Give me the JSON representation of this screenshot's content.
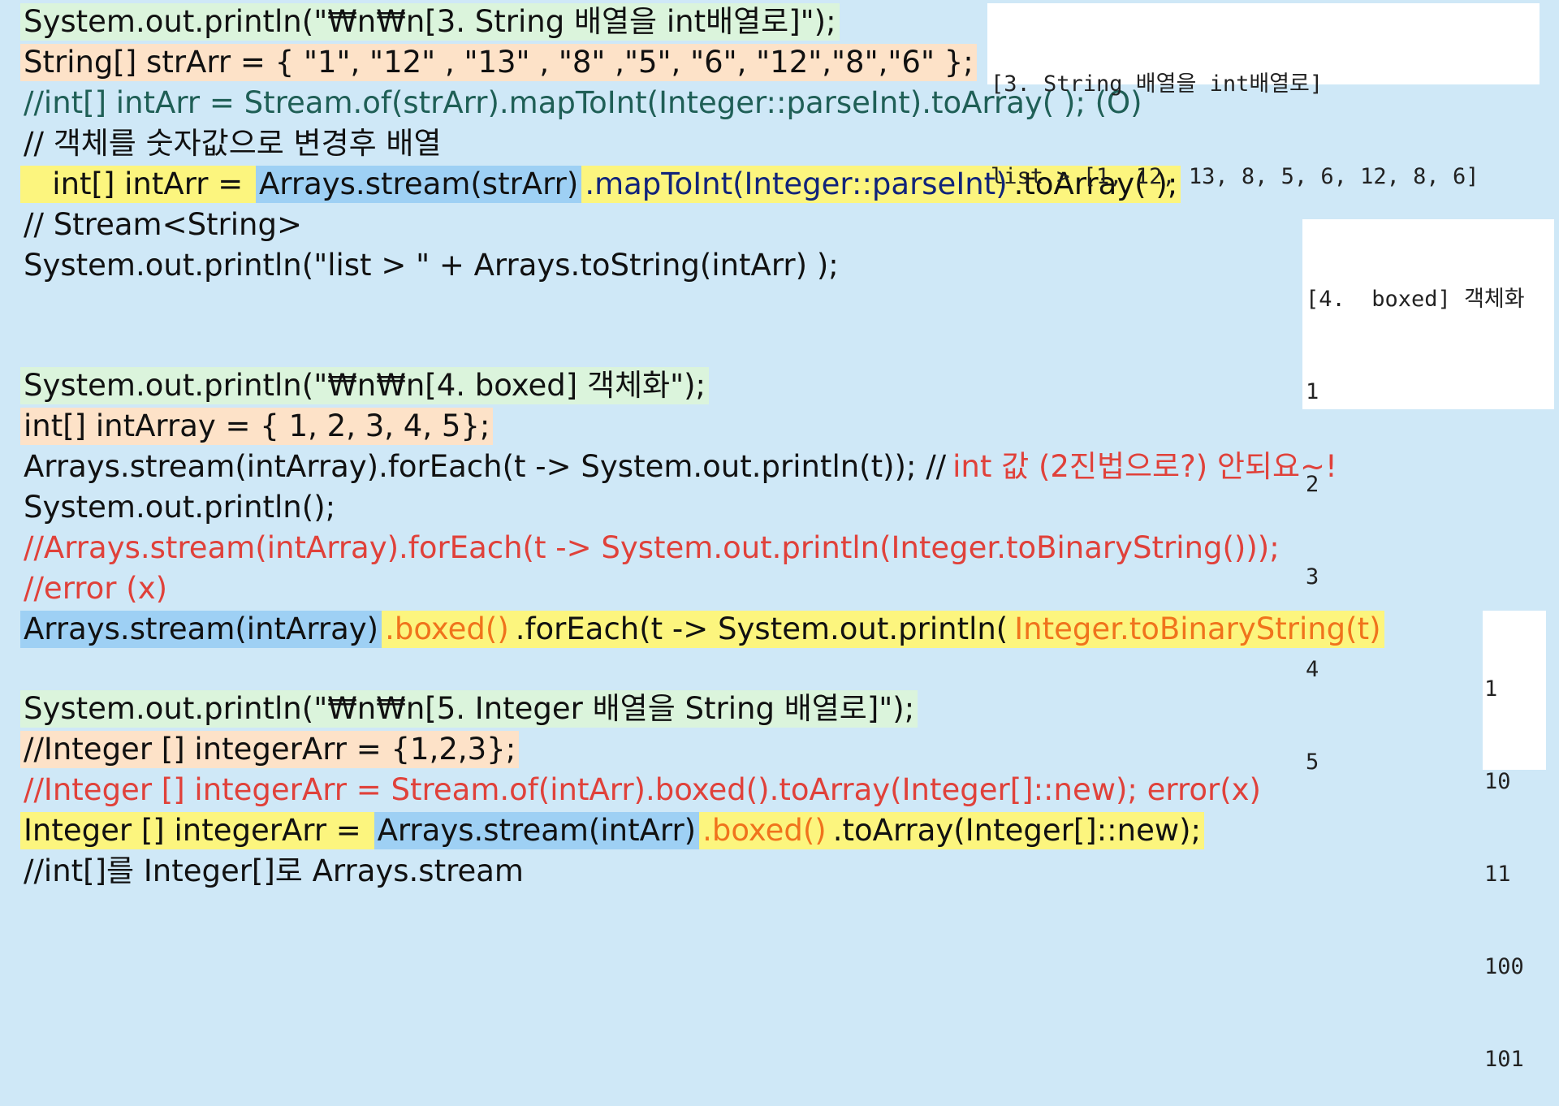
{
  "code_lines": [
    {
      "id": "line-print-section3",
      "segments": [
        {
          "text": "System.out.println(\"₩n₩n[3. String 배열을 int배열로]\");",
          "hl": "green",
          "color": "dark"
        }
      ]
    },
    {
      "id": "line-strarr-decl",
      "segments": [
        {
          "text": "String[] strArr = { \"1\", \"12\" , \"13\" , \"8\" ,\"5\", \"6\", \"12\",\"8\",\"6\" };",
          "hl": "peach",
          "color": "dark"
        }
      ]
    },
    {
      "id": "line-comment-stream-of",
      "segments": [
        {
          "text": "//int[] intArr = Stream.of(strArr).mapToInt(Integer::parseInt).toArray( ); (O)",
          "hl": "",
          "color": "teal"
        }
      ]
    },
    {
      "id": "line-comment-korean",
      "segments": [
        {
          "text": "// 객체를 숫자값으로 변경후 배열",
          "hl": "",
          "color": "dark"
        }
      ]
    },
    {
      "id": "line-intarr-stream",
      "segments": [
        {
          "text": "   int[] intArr = ",
          "hl": "yellow",
          "color": "dark"
        },
        {
          "text": "Arrays.stream(strArr)",
          "hl": "blue",
          "color": "dark"
        },
        {
          "text": ".mapToInt(Integer::parseInt)",
          "hl": "yellow",
          "color": "navy"
        },
        {
          "text": ".toArray( );",
          "hl": "yellow",
          "color": "dark"
        }
      ]
    },
    {
      "id": "line-comment-stream-string",
      "segments": [
        {
          "text": "// Stream<String>",
          "hl": "",
          "color": "dark"
        }
      ]
    },
    {
      "id": "line-print-list",
      "segments": [
        {
          "text": "System.out.println(\"list > \" + Arrays.toString(intArr) );",
          "hl": "",
          "color": "dark"
        }
      ]
    },
    {
      "id": "line-print-section4",
      "segments": [
        {
          "text": "System.out.println(\"₩n₩n[4. boxed] 객체화\");",
          "hl": "green",
          "color": "dark"
        }
      ]
    },
    {
      "id": "line-intarray-decl",
      "segments": [
        {
          "text": "int[] intArray = { 1, 2, 3, 4, 5};",
          "hl": "peach",
          "color": "dark"
        }
      ]
    },
    {
      "id": "line-foreach-print",
      "segments": [
        {
          "text": "Arrays.stream(intArray).forEach(t -> System.out.println(t)); //",
          "hl": "",
          "color": "dark"
        },
        {
          "text": "int 값 (2진법으로?) 안되요~!",
          "hl": "",
          "color": "red"
        }
      ]
    },
    {
      "id": "line-println-empty",
      "segments": [
        {
          "text": "System.out.println();",
          "hl": "",
          "color": "dark"
        }
      ]
    },
    {
      "id": "line-comment-binary",
      "segments": [
        {
          "text": "//Arrays.stream(intArray).forEach(t -> System.out.println(Integer.toBinaryString()));",
          "hl": "",
          "color": "red"
        }
      ]
    },
    {
      "id": "line-comment-error",
      "segments": [
        {
          "text": "//error (x)",
          "hl": "",
          "color": "red"
        }
      ]
    },
    {
      "id": "line-boxed-foreach",
      "segments": [
        {
          "text": "Arrays.stream(intArray)",
          "hl": "blue",
          "color": "dark"
        },
        {
          "text": ".boxed()",
          "hl": "yellow",
          "color": "orange"
        },
        {
          "text": ".forEach(t -> System.out.println(",
          "hl": "yellow",
          "color": "dark"
        },
        {
          "text": "Integer.toBinaryString(t)",
          "hl": "yellow",
          "color": "orange"
        }
      ]
    },
    {
      "id": "line-print-section5",
      "segments": [
        {
          "text": "System.out.println(\"₩n₩n[5. Integer 배열을 String 배열로]\");",
          "hl": "green",
          "color": "dark"
        }
      ]
    },
    {
      "id": "line-comment-integerarr",
      "segments": [
        {
          "text": "//Integer [] integerArr = {1,2,3};",
          "hl": "peach",
          "color": "dark"
        }
      ]
    },
    {
      "id": "line-comment-stream-error",
      "segments": [
        {
          "text": "//Integer [] integerArr = Stream.of(intArr).boxed().toArray(Integer[]::new); error(x)",
          "hl": "",
          "color": "red"
        }
      ]
    },
    {
      "id": "line-integerarr-stream",
      "segments": [
        {
          "text": "Integer [] integerArr = ",
          "hl": "yellow",
          "color": "dark"
        },
        {
          "text": "Arrays.stream(intArr)",
          "hl": "blue",
          "color": "dark"
        },
        {
          "text": ".boxed()",
          "hl": "yellow",
          "color": "orange"
        },
        {
          "text": ".toArray(Integer[]::new);",
          "hl": "yellow",
          "color": "dark"
        }
      ]
    },
    {
      "id": "line-comment-cutoff",
      "segments": [
        {
          "text": "//int[]를 Integer[]로 Arrays.stream",
          "hl": "",
          "color": "dark"
        }
      ]
    }
  ],
  "console_outputs": [
    {
      "id": "console-output-section3",
      "lines": [
        "[3. String 배열을 int배열로]",
        "list > [1, 12, 13, 8, 5, 6, 12, 8, 6]"
      ]
    },
    {
      "id": "console-output-section4",
      "lines": [
        "[4.  boxed] 객체화",
        "1",
        "2",
        "3",
        "4",
        "5"
      ]
    },
    {
      "id": "console-output-binary",
      "lines": [
        "1",
        "10",
        "11",
        "100",
        "101"
      ]
    }
  ],
  "colors": {
    "background": "#cfe8f7",
    "highlight_green": "#dbf4dc",
    "highlight_peach": "#fde2c8",
    "highlight_yellow": "#fcf57e",
    "highlight_blue": "#9ed0f4",
    "text_dark": "#111111",
    "text_teal": "#1f5f56",
    "text_navy": "#11247a",
    "text_red": "#e0413a",
    "text_orange": "#f0731c"
  }
}
